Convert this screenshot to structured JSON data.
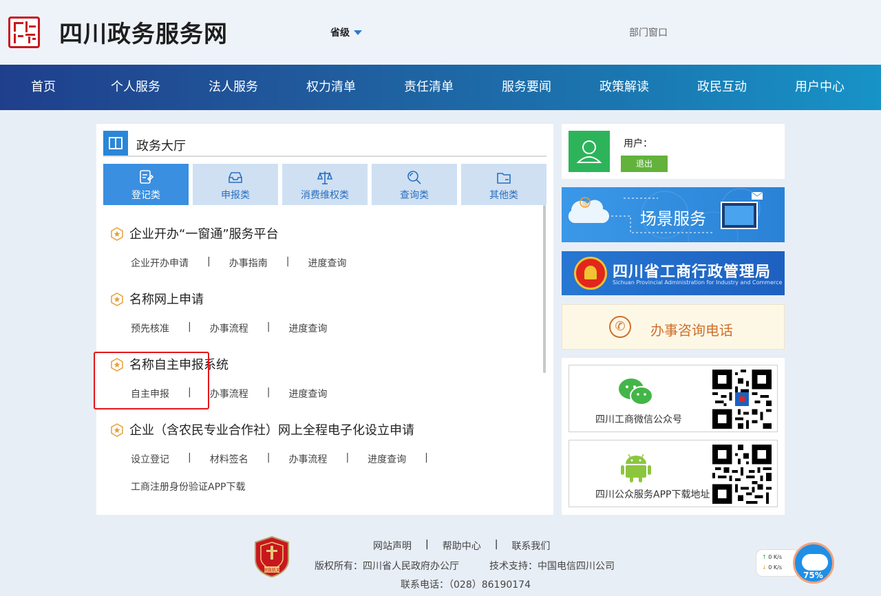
{
  "header": {
    "site_title": "四川政务服务网",
    "level_select": "省级",
    "dept_link": "部门窗口"
  },
  "nav": {
    "items": [
      "首页",
      "个人服务",
      "法人服务",
      "权力清单",
      "责任清单",
      "服务要闻",
      "政策解读",
      "政民互动",
      "用户中心"
    ]
  },
  "hall": {
    "title": "政务大厅",
    "categories": [
      {
        "label": "登记类",
        "icon": "register-icon",
        "active": true
      },
      {
        "label": "申报类",
        "icon": "inbox-icon",
        "active": false
      },
      {
        "label": "消费维权类",
        "icon": "scale-icon",
        "active": false
      },
      {
        "label": "查询类",
        "icon": "search-icon",
        "active": false
      },
      {
        "label": "其他类",
        "icon": "folder-icon",
        "active": false
      }
    ],
    "services": [
      {
        "title": "企业开办“一窗通”服务平台",
        "links": [
          "企业开办申请",
          "办事指南",
          "进度查询"
        ]
      },
      {
        "title": "名称网上申请",
        "links": [
          "预先核准",
          "办事流程",
          "进度查询"
        ]
      },
      {
        "title": "名称自主申报系统",
        "links": [
          "自主申报",
          "办事流程",
          "进度查询"
        ]
      },
      {
        "title": "企业（含农民专业合作社）网上全程电子化设立申请",
        "links": [
          "设立登记",
          "材料签名",
          "办事流程",
          "进度查询"
        ],
        "extra": "工商注册身份验证APP下载"
      }
    ]
  },
  "user": {
    "label": "用户：",
    "logout": "退出"
  },
  "banners": {
    "scene": "场景服务",
    "aic_cn": "四川省工商行政管理局",
    "aic_en": "Sichuan Provincial Administration for Industry and Commerce",
    "hotline": "办事咨询电话"
  },
  "qr": {
    "wechat_caption": "四川工商微信公众号",
    "app_caption": "四川公众服务APP下载地址"
  },
  "footer": {
    "links": [
      "网站声明",
      "帮助中心",
      "联系我们"
    ],
    "copyright": "版权所有：四川省人民政府办公厅",
    "tech": "技术支持：中国电信四川公司",
    "contact": "联系电话：（028）86190174",
    "emblem_text": "党政机关"
  },
  "net_widget": {
    "up": "0",
    "down": "0",
    "unit": "K/s",
    "percent": "75%"
  }
}
